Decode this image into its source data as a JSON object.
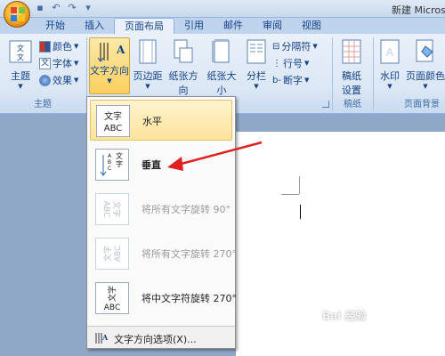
{
  "window": {
    "doc_title": "新建 Microso"
  },
  "tabs": [
    "开始",
    "插入",
    "页面布局",
    "引用",
    "邮件",
    "审阅",
    "视图"
  ],
  "ribbon": {
    "theme": {
      "button": "主题",
      "colors": "颜色",
      "fonts": "字体",
      "effects": "效果",
      "group": "主题"
    },
    "page_setup": {
      "text_direction": "文字方向",
      "margins": "页边距",
      "orientation": "纸张方向",
      "size": "纸张大小",
      "columns": "分栏",
      "breaks": "分隔符",
      "line_numbers": "行号",
      "hyphenation": "断字"
    },
    "draft": {
      "button_line1": "稿纸",
      "button_line2": "设置",
      "group": "稿纸"
    },
    "background": {
      "watermark": "水印",
      "page_color": "页面颜色",
      "group": "页面背景"
    }
  },
  "menu": {
    "items": [
      {
        "label": "水平",
        "icon_lines": [
          "文字",
          "ABC"
        ],
        "state": "highlighted"
      },
      {
        "label": "垂直",
        "icon_lines": [
          "文字",
          "ABC"
        ],
        "state": "normal"
      },
      {
        "label": "将所有文字旋转 90°",
        "icon_lines": [
          "文字",
          "ABC"
        ],
        "state": "disabled"
      },
      {
        "label": "将所有文字旋转 270°",
        "icon_lines": [
          "文字",
          "ABC"
        ],
        "state": "disabled"
      },
      {
        "label": "将中文字符旋转 270°",
        "icon_lines": [
          "文字",
          "ABC"
        ],
        "state": "normal"
      }
    ],
    "footer": "文字方向选项(X)..."
  },
  "annotation": {
    "arrow_color": "#e02020"
  },
  "watermark": {
    "main": "Bai 经验",
    "sub": "jingyan.baidu.com"
  },
  "colors": {
    "ribbon_text": "#15428b",
    "highlight": "#fde39a",
    "arrow": "#e02020"
  }
}
